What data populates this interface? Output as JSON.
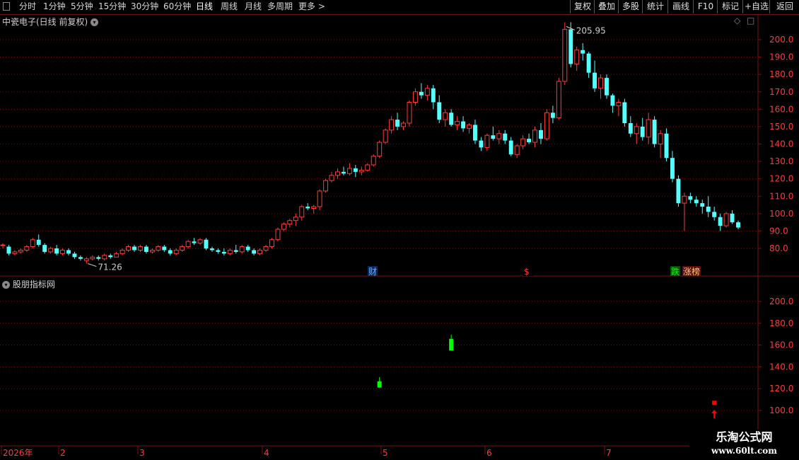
{
  "toolbar": {
    "periods": [
      "分时",
      "1分钟",
      "5分钟",
      "15分钟",
      "30分钟",
      "60分钟",
      "日线",
      "周线",
      "月线",
      "多周期",
      "更多 >"
    ],
    "active_period": "日线",
    "right_buttons": [
      "复权",
      "叠加",
      "多股",
      "统计",
      "画线",
      "F10",
      "标记",
      "+自选",
      "返回"
    ]
  },
  "main_chart": {
    "title": "中瓷电子(日线 前复权)",
    "high_label": "205.95",
    "low_label": "71.26",
    "event_markers": [
      "财",
      "$",
      "跌",
      "涨榜"
    ]
  },
  "indicator": {
    "title": "股朋指标网"
  },
  "time_axis": {
    "labels": [
      "2026年",
      "2",
      "3",
      "4",
      "5",
      "6",
      "7"
    ]
  },
  "watermark": {
    "line1": "乐淘公式网",
    "line2": "www.60lt.com"
  },
  "colors": {
    "up": "#ff3b3b",
    "down": "#54ffff",
    "grid": "#7a1010",
    "signal_green": "#00ff00",
    "signal_red": "#ff0000"
  },
  "chart_data": [
    {
      "type": "candlestick",
      "title": "中瓷电子(日线 前复权)",
      "y_ticks": [
        200.0,
        190.0,
        180.0,
        170.0,
        160.0,
        150.0,
        140.0,
        130.0,
        120.0,
        110.0,
        100.0,
        90.0,
        80.0
      ],
      "ylim": [
        70,
        210
      ],
      "x_ticks": [
        "2026年",
        "2",
        "3",
        "4",
        "5",
        "6",
        "7"
      ],
      "high_annotation": 205.95,
      "low_annotation": 71.26,
      "ohlc": [
        [
          82,
          83,
          80,
          82
        ],
        [
          81,
          82,
          76,
          77
        ],
        [
          77,
          79,
          76,
          78
        ],
        [
          78,
          80,
          77,
          79
        ],
        [
          79,
          82,
          78,
          81
        ],
        [
          81,
          86,
          80,
          85
        ],
        [
          85,
          88,
          81,
          82
        ],
        [
          82,
          83,
          77,
          78
        ],
        [
          78,
          81,
          77,
          80
        ],
        [
          80,
          82,
          76,
          77
        ],
        [
          77,
          80,
          76,
          79
        ],
        [
          79,
          80,
          76,
          77
        ],
        [
          77,
          78,
          74,
          75
        ],
        [
          75,
          76,
          73,
          74
        ],
        [
          73,
          75,
          71.26,
          74
        ],
        [
          74,
          76,
          73,
          75
        ],
        [
          75,
          76,
          73,
          74
        ],
        [
          74,
          77,
          73,
          76
        ],
        [
          76,
          77,
          74,
          75
        ],
        [
          75,
          78,
          75,
          77
        ],
        [
          77,
          80,
          76,
          79
        ],
        [
          79,
          82,
          78,
          81
        ],
        [
          81,
          82,
          78,
          79
        ],
        [
          79,
          82,
          78,
          81
        ],
        [
          81,
          82,
          77,
          78
        ],
        [
          78,
          80,
          77,
          79
        ],
        [
          79,
          82,
          78,
          81
        ],
        [
          81,
          82,
          78,
          79
        ],
        [
          79,
          80,
          76,
          77
        ],
        [
          77,
          80,
          76,
          79
        ],
        [
          79,
          82,
          78,
          81
        ],
        [
          81,
          85,
          80,
          84
        ],
        [
          84,
          86,
          82,
          83
        ],
        [
          83,
          86,
          82,
          85
        ],
        [
          85,
          86,
          79,
          80
        ],
        [
          80,
          81,
          78,
          79
        ],
        [
          79,
          80,
          77,
          78
        ],
        [
          78,
          80,
          76,
          77
        ],
        [
          77,
          80,
          76,
          79
        ],
        [
          79,
          82,
          77,
          78
        ],
        [
          78,
          82,
          77,
          81
        ],
        [
          81,
          82,
          78,
          79
        ],
        [
          79,
          80,
          76,
          77
        ],
        [
          77,
          80,
          76,
          79
        ],
        [
          79,
          82,
          78,
          81
        ],
        [
          81,
          86,
          80,
          85
        ],
        [
          85,
          92,
          84,
          91
        ],
        [
          91,
          95,
          90,
          94
        ],
        [
          94,
          97,
          92,
          96
        ],
        [
          96,
          100,
          93,
          98
        ],
        [
          98,
          105,
          96,
          104
        ],
        [
          104,
          106,
          102,
          103
        ],
        [
          103,
          105,
          100,
          104
        ],
        [
          104,
          114,
          102,
          113
        ],
        [
          113,
          120,
          112,
          119
        ],
        [
          119,
          124,
          118,
          122
        ],
        [
          122,
          126,
          120,
          124
        ],
        [
          124,
          127,
          122,
          123
        ],
        [
          123,
          129,
          122,
          126
        ],
        [
          126,
          128,
          121,
          124
        ],
        [
          124,
          127,
          122,
          125
        ],
        [
          125,
          129,
          124,
          128
        ],
        [
          128,
          134,
          127,
          133
        ],
        [
          133,
          142,
          132,
          141
        ],
        [
          141,
          149,
          140,
          148
        ],
        [
          148,
          156,
          146,
          154
        ],
        [
          154,
          158,
          148,
          150
        ],
        [
          150,
          153,
          148,
          152
        ],
        [
          152,
          165,
          150,
          164
        ],
        [
          164,
          172,
          162,
          170
        ],
        [
          170,
          175,
          166,
          168
        ],
        [
          168,
          174,
          165,
          172
        ],
        [
          172,
          174,
          160,
          164
        ],
        [
          164,
          168,
          152,
          154
        ],
        [
          154,
          160,
          150,
          158
        ],
        [
          158,
          160,
          150,
          151
        ],
        [
          151,
          156,
          148,
          153
        ],
        [
          153,
          156,
          147,
          149
        ],
        [
          149,
          152,
          146,
          151
        ],
        [
          151,
          154,
          140,
          142
        ],
        [
          142,
          144,
          136,
          138
        ],
        [
          138,
          146,
          136,
          145
        ],
        [
          145,
          150,
          142,
          143
        ],
        [
          143,
          148,
          140,
          146
        ],
        [
          146,
          148,
          140,
          142
        ],
        [
          142,
          144,
          133,
          134
        ],
        [
          134,
          140,
          132,
          139
        ],
        [
          139,
          145,
          137,
          143
        ],
        [
          143,
          146,
          140,
          141
        ],
        [
          141,
          150,
          138,
          148
        ],
        [
          148,
          152,
          140,
          143
        ],
        [
          143,
          160,
          142,
          158
        ],
        [
          158,
          162,
          152,
          155
        ],
        [
          155,
          178,
          154,
          176
        ],
        [
          176,
          210,
          174,
          205.95
        ],
        [
          205.95,
          210,
          184,
          186
        ],
        [
          186,
          196,
          182,
          194
        ],
        [
          194,
          198,
          188,
          192
        ],
        [
          192,
          193,
          178,
          181
        ],
        [
          181,
          188,
          170,
          172
        ],
        [
          172,
          180,
          166,
          178
        ],
        [
          178,
          180,
          166,
          168
        ],
        [
          168,
          169,
          158,
          162
        ],
        [
          162,
          166,
          156,
          164
        ],
        [
          164,
          166,
          150,
          152
        ],
        [
          152,
          156,
          144,
          146
        ],
        [
          146,
          152,
          140,
          150
        ],
        [
          150,
          155,
          142,
          144
        ],
        [
          144,
          158,
          140,
          154
        ],
        [
          154,
          156,
          138,
          140
        ],
        [
          140,
          148,
          132,
          146
        ],
        [
          146,
          149,
          130,
          132
        ],
        [
          132,
          136,
          118,
          120
        ],
        [
          120,
          122,
          104,
          106
        ],
        [
          106,
          112,
          90,
          110
        ],
        [
          110,
          112,
          106,
          108
        ],
        [
          108,
          110,
          104,
          106
        ],
        [
          106,
          108,
          100,
          104
        ],
        [
          104,
          110,
          98,
          101
        ],
        [
          101,
          104,
          96,
          98
        ],
        [
          98,
          100,
          90,
          93
        ],
        [
          93,
          101,
          92,
          100
        ],
        [
          100,
          102,
          94,
          95
        ],
        [
          95,
          96,
          91,
          92
        ]
      ]
    },
    {
      "type": "indicator_signals",
      "title": "股朋指标网",
      "y_ticks": [
        200.0,
        180.0,
        160.0,
        140.0,
        120.0,
        100.0
      ],
      "ylim": [
        90,
        210
      ],
      "signals": [
        {
          "index": 63,
          "kind": "green_bar",
          "low": 121,
          "high": 128
        },
        {
          "index": 75,
          "kind": "green_bar",
          "low": 155,
          "high": 167
        },
        {
          "index": 119,
          "kind": "red_square",
          "value": 107
        },
        {
          "index": 119,
          "kind": "red_arrow",
          "value": 96
        }
      ]
    }
  ]
}
